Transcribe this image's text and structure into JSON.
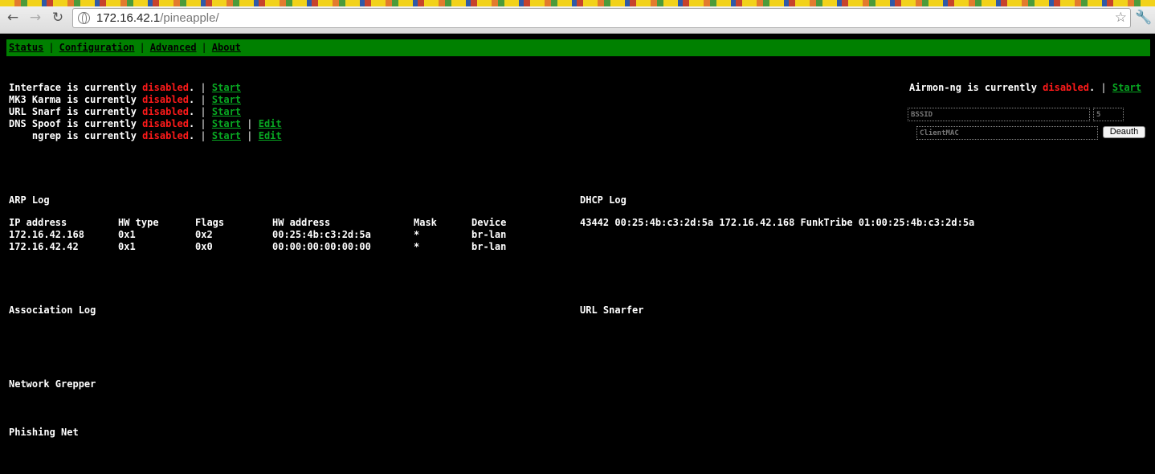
{
  "browser": {
    "url_host": "172.16.42.1",
    "url_path": "/pineapple/"
  },
  "menu": [
    "Status",
    "Configuration",
    "Advanced",
    "About"
  ],
  "status_rows": [
    {
      "label": "Interface is currently ",
      "state": "disabled",
      "action": "Start"
    },
    {
      "label": "MK3 Karma is currently ",
      "state": "disabled",
      "action": "Start"
    },
    {
      "label": "URL Snarf is currently ",
      "state": "disabled",
      "action": "Start"
    },
    {
      "label": "DNS Spoof is currently ",
      "state": "disabled",
      "action": "Start",
      "edit": "Edit"
    },
    {
      "label": "    ngrep is currently ",
      "state": "disabled",
      "action": "Start",
      "edit": "Edit"
    }
  ],
  "airmon": {
    "label": "Airmon-ng is currently ",
    "state": "disabled",
    "action": "Start"
  },
  "deauth_form": {
    "bssid_placeholder": "BSSID",
    "count_value": "5",
    "client_placeholder": "ClientMAC",
    "button": "Deauth"
  },
  "arp_log": {
    "heading": "ARP Log",
    "columns": [
      "IP address",
      "HW type",
      "Flags",
      "HW address",
      "Mask",
      "Device"
    ],
    "rows": [
      [
        "172.16.42.168",
        "0x1",
        "0x2",
        "00:25:4b:c3:2d:5a",
        "*",
        "br-lan"
      ],
      [
        "172.16.42.42",
        "0x1",
        "0x0",
        "00:00:00:00:00:00",
        "*",
        "br-lan"
      ]
    ]
  },
  "dhcp_log": {
    "heading": "DHCP Log",
    "entry": "43442 00:25:4b:c3:2d:5a 172.16.42.168 FunkTribe 01:00:25:4b:c3:2d:5a"
  },
  "sections": {
    "association_log": "Association Log",
    "url_snarfer": "URL Snarfer",
    "network_grepper": "Network Grepper",
    "phishing_net": "Phishing Net"
  },
  "colors": {
    "menu_bg": "#008000",
    "link": "#08a822",
    "disabled": "#ff1a1a"
  }
}
